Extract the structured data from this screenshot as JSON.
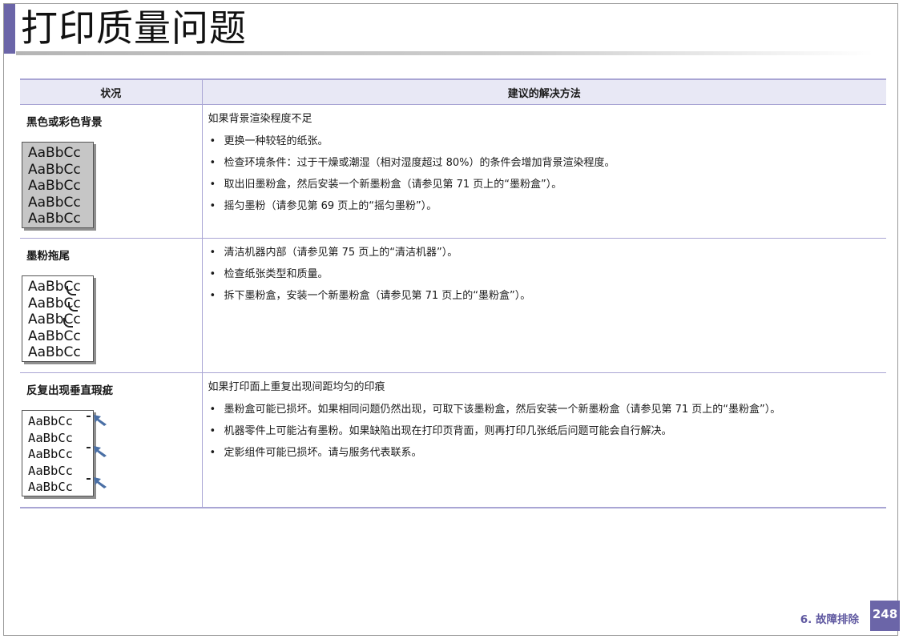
{
  "page": {
    "title": "打印质量问题",
    "section": "6.  故障排除",
    "page_number": "248"
  },
  "table": {
    "headers": {
      "condition": "状况",
      "solution": "建议的解决方法"
    },
    "rows": [
      {
        "condition": "黑色或彩色背景",
        "sample_lines": [
          "AaBbCc",
          "AaBbCc",
          "AaBbCc",
          "AaBbCc",
          "AaBbCc"
        ],
        "intro": "如果背景渲染程度不足",
        "bullets": [
          "更换一种较轻的纸张。",
          "检查环境条件：过于干燥或潮湿（相对湿度超过 80%）的条件会增加背景渲染程度。",
          "取出旧墨粉盒，然后安装一个新墨粉盒（请参见第 71 页上的“墨粉盒”）。",
          "摇匀墨粉（请参见第 69 页上的“摇匀墨粉”）。"
        ]
      },
      {
        "condition": "墨粉拖尾",
        "sample_lines": [
          "AaBbCc",
          "AaBbCc",
          "AaBbCc",
          "AaBbCc",
          "AaBbCc"
        ],
        "intro": "",
        "bullets": [
          "清洁机器内部（请参见第 75 页上的“清洁机器”）。",
          "检查纸张类型和质量。",
          "拆下墨粉盒，安装一个新墨粉盒（请参见第 71 页上的“墨粉盒”）。"
        ]
      },
      {
        "condition": "反复出现垂直瑕疵",
        "sample_lines": [
          "AaBbCc",
          "AaBbCc",
          "AaBbCc",
          "AaBbCc",
          "AaBbCc"
        ],
        "intro": "如果打印面上重复出现间距均匀的印痕",
        "bullets": [
          "墨粉盒可能已损坏。如果相同问题仍然出现，可取下该墨粉盒，然后安装一个新墨粉盒（请参见第 71 页上的“墨粉盒”）。",
          "机器零件上可能沾有墨粉。如果缺陷出现在打印页背面，则再打印几张纸后问题可能会自行解决。",
          "定影组件可能已损坏。请与服务代表联系。"
        ]
      }
    ]
  },
  "bullet_symbol": "•",
  "colors": {
    "accent": "#6b65a8",
    "table_header_bg": "#e8e8f5",
    "table_rule": "#a9a5d4"
  }
}
